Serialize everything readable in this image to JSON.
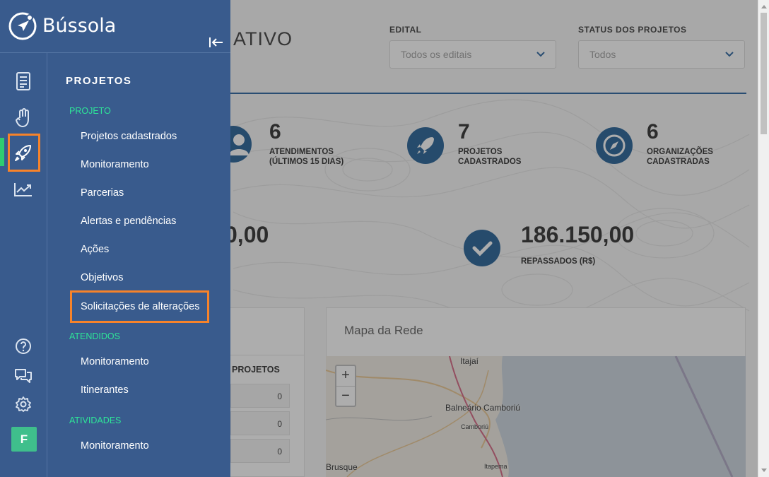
{
  "app": {
    "brand_name": "Bússola",
    "colors": {
      "sidebar": "#395b8d",
      "accent_green": "#2ecc71",
      "section_green": "#2ee598",
      "highlight_orange": "#f7832a",
      "stat_blue": "#17568f"
    }
  },
  "dashboard": {
    "title_fragment": "ATIVO",
    "filters": [
      {
        "label": "EDITAL",
        "value": "Todos os editais"
      },
      {
        "label": "STATUS DOS PROJETOS",
        "value": "Todos"
      }
    ],
    "stats": [
      {
        "icon": "user-icon",
        "value": "6",
        "label": "ATENDIMENTOS\n(ÚLTIMOS 15 DIAS)"
      },
      {
        "icon": "rocket-icon",
        "value": "7",
        "label": "PROJETOS\nCADASTRADOS"
      },
      {
        "icon": "compass-icon",
        "value": "6",
        "label": "ORGANIZAÇÕES\nCADASTRADAS"
      }
    ],
    "money_left": "0,00",
    "money_right": {
      "value": "186.150,00",
      "label": "REPASSADOS (R$)"
    },
    "table": {
      "header": "PROJETOS",
      "values": [
        "0",
        "0",
        "0"
      ]
    },
    "map": {
      "title": "Mapa da Rede",
      "zoom_in": "+",
      "zoom_out": "−",
      "places": {
        "itajai": "Itajaí",
        "balneario": "Balneário Camboriú",
        "camboriu": "Camboriú",
        "brusque": "Brusque",
        "itapema": "Itapema"
      }
    }
  },
  "sidebar": {
    "menu_title": "PROJETOS",
    "rail_icons": [
      "document-icon",
      "hand-icon",
      "rocket-icon",
      "chart-line-icon",
      "help-icon",
      "chat-icon",
      "settings-icon"
    ],
    "user_initial": "F",
    "sections": [
      {
        "title": "PROJETO",
        "items": [
          "Projetos cadastrados",
          "Monitoramento",
          "Parcerias",
          "Alertas e pendências",
          "Ações",
          "Objetivos",
          "Solicitações de alterações"
        ]
      },
      {
        "title": "ATENDIDOS",
        "items": [
          "Monitoramento",
          "Itinerantes"
        ]
      },
      {
        "title": "ATIVIDADES",
        "items": [
          "Monitoramento"
        ]
      }
    ]
  }
}
